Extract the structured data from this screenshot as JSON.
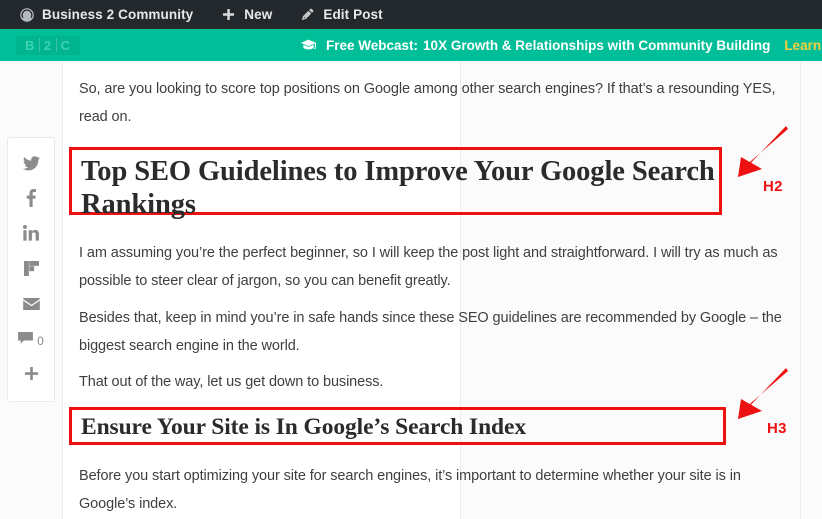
{
  "adminbar": {
    "site_icon": "dashboard-icon",
    "site_name": "Business 2 Community",
    "new_icon": "plus-icon",
    "new_label": "New",
    "edit_icon": "pencil-icon",
    "edit_label": "Edit Post"
  },
  "banner": {
    "logo": {
      "b": "B",
      "two": "2",
      "c": "C"
    },
    "icon": "graduation-cap-icon",
    "prefix": "Free Webcast:",
    "title": "10X Growth & Relationships with Community Building",
    "cta": "Learn",
    "bg_color": "#00bf98",
    "cta_color": "#f4d03f"
  },
  "share_rail": {
    "items": [
      {
        "name": "twitter-share",
        "icon": "twitter-icon",
        "count": ""
      },
      {
        "name": "facebook-share",
        "icon": "facebook-icon",
        "count": ""
      },
      {
        "name": "linkedin-share",
        "icon": "linkedin-icon",
        "count": ""
      },
      {
        "name": "flipboard-share",
        "icon": "flipboard-icon",
        "count": ""
      },
      {
        "name": "email-share",
        "icon": "envelope-icon",
        "count": ""
      },
      {
        "name": "comments",
        "icon": "comment-icon",
        "count": "0"
      },
      {
        "name": "more-share",
        "icon": "plus-icon",
        "count": ""
      }
    ]
  },
  "article": {
    "p1": "So, are you looking to score top positions on Google among other search engines? If that’s a resounding YES, read on.",
    "h2": "Top SEO Guidelines to Improve Your Google Search Rankings",
    "p2": "I am assuming you’re the perfect beginner, so I will keep the post light and straightforward. I will try as much as possible to steer clear of jargon, so you can benefit greatly.",
    "p3": "Besides that, keep in mind you’re in safe hands since these SEO guidelines are recommended by Google – the biggest search engine in the world.",
    "p4": "That out of the way, let us get down to business.",
    "h3": "Ensure Your Site is In Google’s Search Index",
    "p5": "Before you start optimizing your site for search engines, it’s important to determine whether your site is in Google’s index."
  },
  "annotations": {
    "color": "#ee1111",
    "h2_label": "H2",
    "h3_label": "H3"
  }
}
